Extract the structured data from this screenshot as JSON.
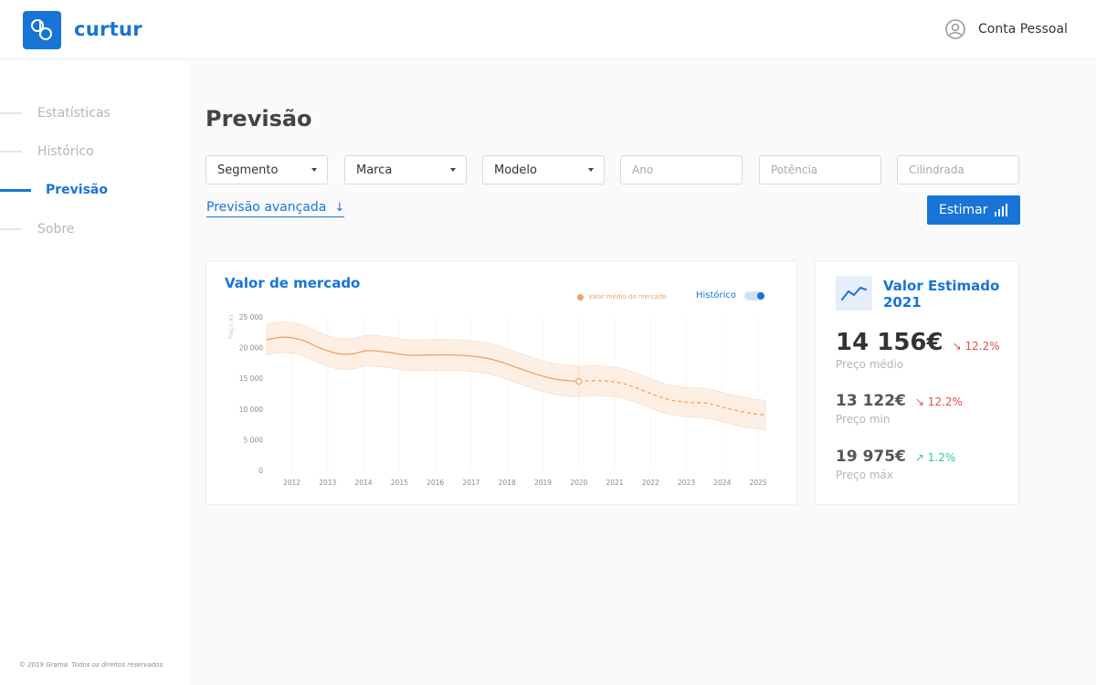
{
  "brand": {
    "name": "curtur",
    "color": "#1874d6"
  },
  "header": {
    "account_label": "Conta Pessoal"
  },
  "sidebar": {
    "items": [
      {
        "label": "Estatísticas",
        "active": false
      },
      {
        "label": "Histórico",
        "active": false
      },
      {
        "label": "Previsão",
        "active": true
      },
      {
        "label": "Sobre",
        "active": false
      }
    ],
    "footer": "© 2019 Grama. Todos os direitos reservados."
  },
  "page": {
    "title": "Previsão"
  },
  "filters": {
    "selects": [
      {
        "label": "Segmento"
      },
      {
        "label": "Marca"
      },
      {
        "label": "Modelo"
      }
    ],
    "inputs": [
      {
        "placeholder": "Ano"
      },
      {
        "placeholder": "Potência"
      },
      {
        "placeholder": "Cilindrada"
      }
    ],
    "advanced_label": "Previsão avançada",
    "estimate_button": "Estimar"
  },
  "chart_card": {
    "title": "Valor de mercado",
    "legend_label": "Valor médio do mercado",
    "toggle_label": "Histórico",
    "toggle_on": true
  },
  "chart_data": {
    "type": "line",
    "ylabel": "Preço (€)",
    "ylim": [
      0,
      25000
    ],
    "yticks": [
      "25 000",
      "20 000",
      "15 000",
      "10 000",
      "5 000",
      "0"
    ],
    "ytick_values": [
      25000,
      20000,
      15000,
      10000,
      5000,
      0
    ],
    "xticks": [
      "2012",
      "2013",
      "2014",
      "2015",
      "2016",
      "2017",
      "2018",
      "2019",
      "2020",
      "2021",
      "2022",
      "2023",
      "2024",
      "2025"
    ],
    "xlim": [
      2011.3,
      2025.2
    ],
    "series": [
      {
        "name": "Valor médio do mercado",
        "color": "#f0a264",
        "x": [
          2011.3,
          2011.8,
          2012.3,
          2012.8,
          2013.3,
          2013.7,
          2014.1,
          2014.6,
          2015.2,
          2015.8,
          2016.5,
          2017.2,
          2017.7,
          2018.2,
          2018.8,
          2019.4,
          2020.0
        ],
        "y": [
          21300,
          21700,
          21200,
          19900,
          19000,
          19000,
          19500,
          19300,
          18800,
          18800,
          18800,
          18500,
          17900,
          16900,
          15700,
          14800,
          14500
        ],
        "band_width": 2500
      },
      {
        "name": "Previsão",
        "color": "#f0a264",
        "dashed": true,
        "x": [
          2020.0,
          2020.6,
          2021.2,
          2021.8,
          2022.4,
          2023.0,
          2023.6,
          2024.2,
          2024.8,
          2025.2
        ],
        "y": [
          14500,
          14600,
          14200,
          13000,
          11700,
          11100,
          10900,
          10000,
          9300,
          9000
        ],
        "band_width": 2400
      }
    ],
    "marker": {
      "x": 2020.0,
      "y": 14500
    }
  },
  "estimate": {
    "title": "Valor Estimado 2021",
    "stats": [
      {
        "value": "14 156€",
        "change": "12.2%",
        "direction": "down",
        "label": "Preço médio"
      },
      {
        "value": "13 122€",
        "change": "12.2%",
        "direction": "down",
        "label": "Preço min"
      },
      {
        "value": "19 975€",
        "change": "1.2%",
        "direction": "up",
        "label": "Preço máx"
      }
    ]
  }
}
